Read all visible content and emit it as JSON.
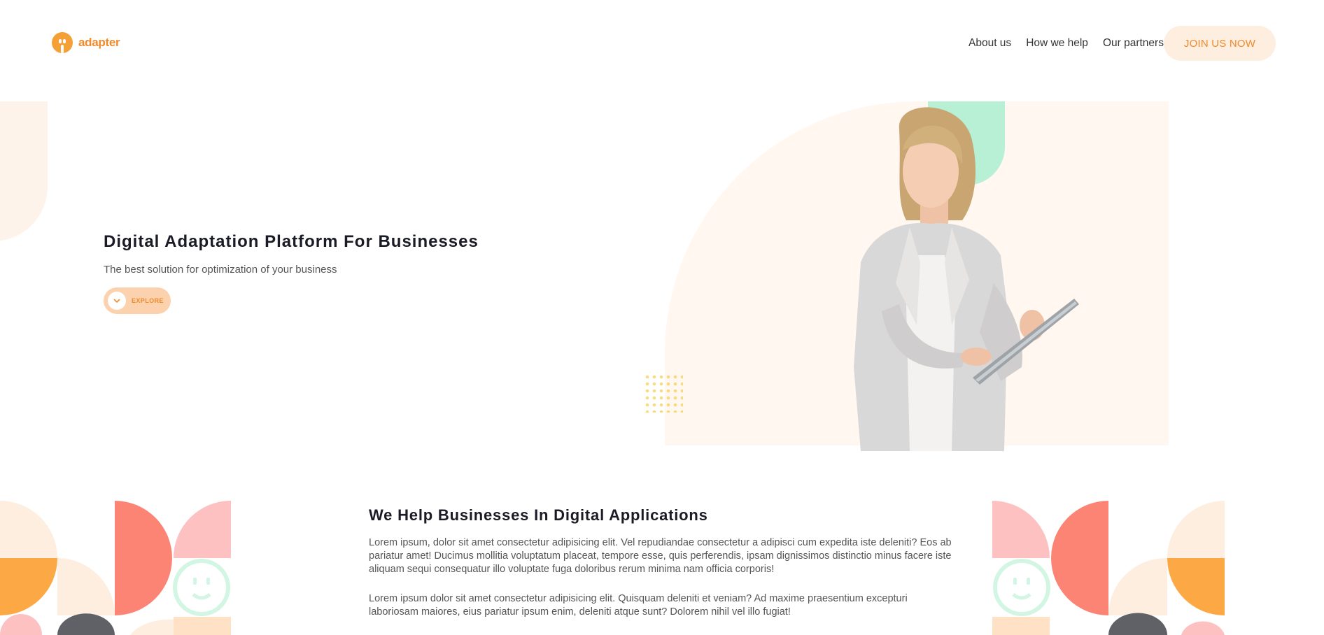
{
  "brand": {
    "name": "adapter",
    "accent": "#f08a2c"
  },
  "nav": {
    "items": [
      {
        "label": "About us"
      },
      {
        "label": "How we help"
      },
      {
        "label": "Our partners"
      }
    ],
    "join_label": "JOIN US NOW"
  },
  "hero": {
    "title": "Digital Adaptation Platform For Businesses",
    "subtitle": "The best solution for optimization of your business",
    "explore_label": "EXPLORE"
  },
  "section": {
    "title": "We Help Businesses In Digital Applications",
    "paragraph1": "Lorem ipsum, dolor sit amet consectetur adipisicing elit. Vel repudiandae consectetur a adipisci cum expedita iste deleniti? Eos ab pariatur amet! Ducimus mollitia voluptatum placeat, tempore esse, quis perferendis, ipsam dignissimos distinctio minus facere iste aliquam sequi consequatur illo voluptate fuga doloribus rerum minima nam officia corporis!",
    "paragraph2": "Lorem ipsum dolor sit amet consectetur adipisicing elit. Quisquam deleniti et veniam? Ad maxime praesentium excepturi laboriosam maiores, eius pariatur ipsum enim, deleniti atque sunt? Dolorem nihil vel illo fugiat!"
  },
  "icons": {
    "logo": "plug-face-icon",
    "explore": "chevron-down-icon",
    "decor": "smiley-face-icon"
  },
  "colors": {
    "peach": "#fdeee0",
    "salmon": "#fc8475",
    "pink": "#fdc1c1",
    "orange": "#fca945",
    "mint": "#b8f0d6",
    "charcoal": "#5f6166"
  }
}
